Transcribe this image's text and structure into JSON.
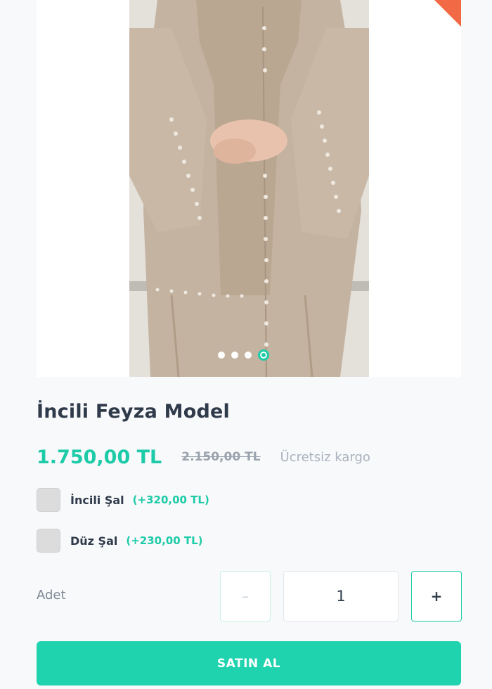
{
  "product": {
    "title": "İncili Feyza Model",
    "price": "1.750,00 TL",
    "old_price": "2.150,00 TL",
    "shipping_note": "Ücretsiz kargo"
  },
  "gallery": {
    "image_description": "beige-abaya-with-pearl-trim",
    "slide_count": 4,
    "active_slide": 4
  },
  "options": [
    {
      "label": "İncili Şal",
      "price": "(+320,00 TL)",
      "checked": false
    },
    {
      "label": "Düz Şal",
      "price": "(+230,00 TL)",
      "checked": false
    }
  ],
  "quantity": {
    "label": "Adet",
    "value": "1",
    "minus_symbol": "–",
    "plus_symbol": "+"
  },
  "buy_button_label": "SATIN AL",
  "colors": {
    "accent": "#1ecba8",
    "ribbon": "#f26a45"
  }
}
